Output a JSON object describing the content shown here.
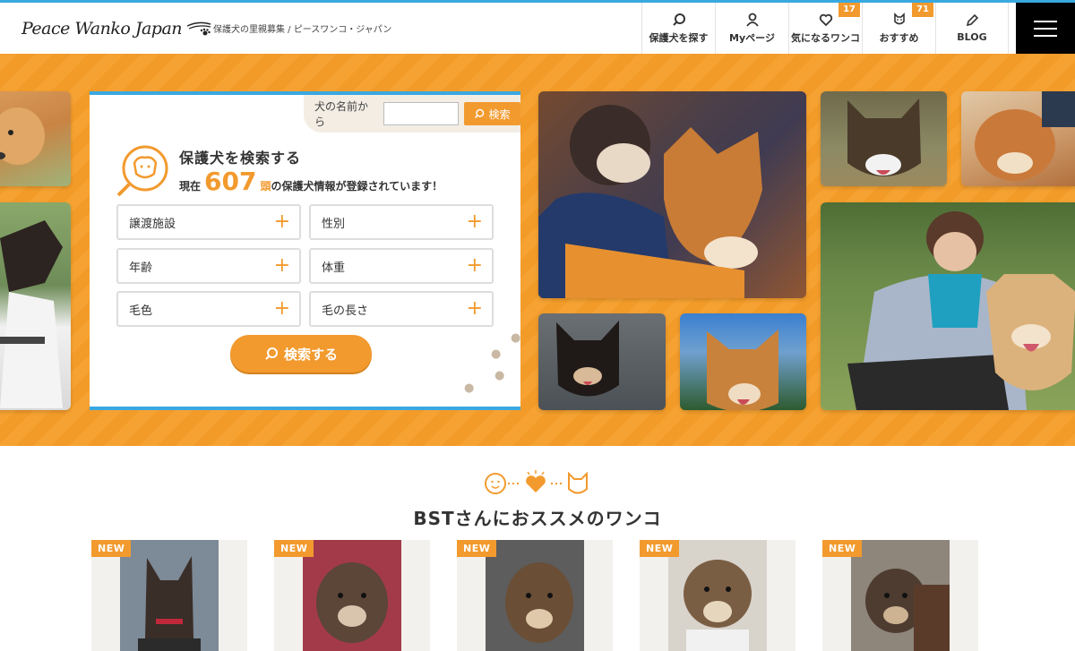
{
  "header": {
    "logo_text": "Peace Wanko Japan",
    "tagline": "保護犬の里親募集 / ピースワンコ・ジャパン"
  },
  "nav": [
    {
      "label": "保護犬を探す",
      "icon": "search-icon",
      "badge": null
    },
    {
      "label": "Myページ",
      "icon": "user-icon",
      "badge": null
    },
    {
      "label": "気になるワンコ",
      "icon": "heart-icon",
      "badge": "17"
    },
    {
      "label": "おすすめ",
      "icon": "dog-face-icon",
      "badge": "71"
    },
    {
      "label": "BLOG",
      "icon": "pencil-icon",
      "badge": null
    }
  ],
  "search": {
    "name_label": "犬の名前から",
    "name_placeholder": "",
    "name_button": "検索",
    "title": "保護犬を検索する",
    "count_prefix": "現在",
    "count": "607",
    "count_unit": "頭",
    "count_suffix": "の保護犬情報が登録されています！",
    "filters": [
      "譲渡施設",
      "性別",
      "年齢",
      "体重",
      "毛色",
      "毛の長さ"
    ],
    "submit": "検索する"
  },
  "recommend": {
    "title": "BSTさんにおススメのワンコ",
    "new_label": "NEW",
    "cards": 5
  },
  "colors": {
    "accent": "#f29a2e",
    "blue": "#3aa8e0",
    "hero_bg": "#f5a232"
  }
}
